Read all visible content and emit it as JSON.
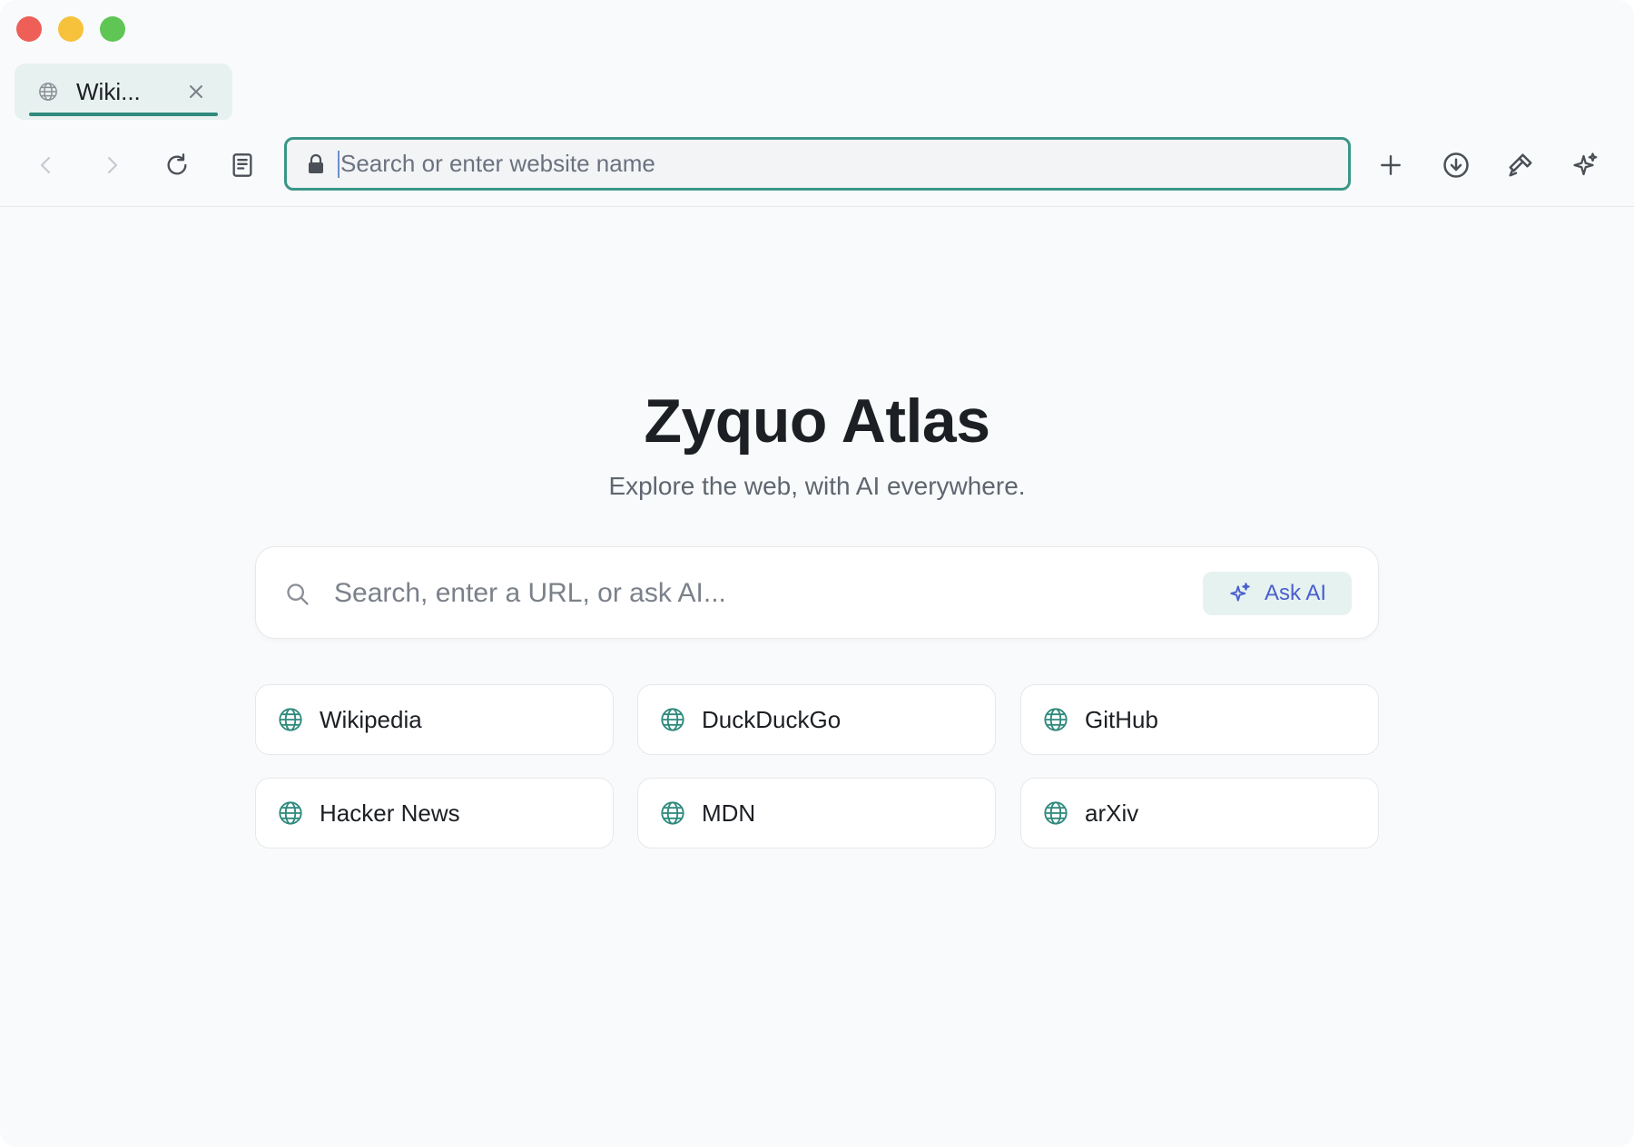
{
  "tab": {
    "title": "Wiki...",
    "icon": "globe-icon"
  },
  "toolbar": {
    "address_placeholder": "Search or enter website name",
    "back_icon": "chevron-left-icon",
    "forward_icon": "chevron-right-icon",
    "reload_icon": "reload-icon",
    "reader_icon": "document-icon",
    "new_tab_icon": "plus-icon",
    "downloads_icon": "download-icon",
    "tools_icon": "hammer-icon",
    "ai_icon": "sparkle-icon"
  },
  "home": {
    "title": "Zyquo Atlas",
    "subtitle": "Explore the web, with AI everywhere.",
    "search_placeholder": "Search, enter a URL, or ask AI...",
    "ask_ai_label": "Ask AI"
  },
  "quick_links": [
    {
      "label": "Wikipedia"
    },
    {
      "label": "DuckDuckGo"
    },
    {
      "label": "GitHub"
    },
    {
      "label": "Hacker News"
    },
    {
      "label": "MDN"
    },
    {
      "label": "arXiv"
    }
  ],
  "colors": {
    "accent": "#2f8a7d",
    "ask_ai_text": "#4a5fd0",
    "close": "#ee5f57",
    "minimize": "#f6c23c",
    "maximize": "#5fc655"
  }
}
